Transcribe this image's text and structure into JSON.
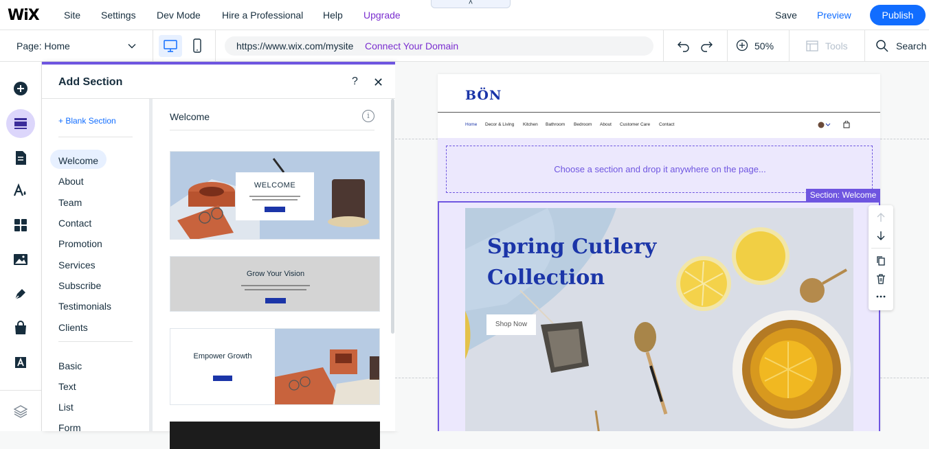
{
  "topbar": {
    "logo": "WiX",
    "menu": [
      "Site",
      "Settings",
      "Dev Mode",
      "Hire a Professional",
      "Help",
      "Upgrade"
    ],
    "pull_tab": "˄",
    "save": "Save",
    "preview": "Preview",
    "publish": "Publish",
    "colors": {
      "accent": "#116dff",
      "upgrade": "#7a2ecf"
    }
  },
  "toolbar": {
    "page_label": "Page: Home",
    "url": "https://www.wix.com/mysite",
    "connect_domain": "Connect Your Domain",
    "zoom": "50%",
    "tools": "Tools",
    "search": "Search"
  },
  "rail": {
    "icons": [
      "add-icon",
      "sections-icon",
      "pages-icon",
      "theme-icon",
      "apps-icon",
      "media-icon",
      "pen-icon",
      "store-icon",
      "text-app-icon",
      "layers-icon"
    ]
  },
  "panel": {
    "title": "Add Section",
    "help": "?",
    "close": "✕",
    "blank_section": "+  Blank Section",
    "categories_primary": [
      "Welcome",
      "About",
      "Team",
      "Contact",
      "Promotion",
      "Services",
      "Subscribe",
      "Testimonials",
      "Clients"
    ],
    "categories_secondary": [
      "Basic",
      "Text",
      "List",
      "Form"
    ],
    "active_category": "Welcome",
    "gallery_title": "Welcome",
    "info": "i",
    "templates": [
      {
        "heading": "WELCOME"
      },
      {
        "heading": "Grow Your Vision"
      },
      {
        "heading": "Empower Growth"
      }
    ]
  },
  "site": {
    "logo": "BÖN",
    "nav": [
      "Home",
      "Decor & Living",
      "Kitchen",
      "Bathroom",
      "Bedroom",
      "About",
      "Customer Care",
      "Contact"
    ],
    "drop_text": "Choose a section and drop it anywhere on the page...",
    "section_tag": "Section: Welcome",
    "hero_title": "Spring Cutlery Collection",
    "shop_now": "Shop Now",
    "colors": {
      "brand": "#1b35a8",
      "selection": "#6e55e0"
    }
  }
}
